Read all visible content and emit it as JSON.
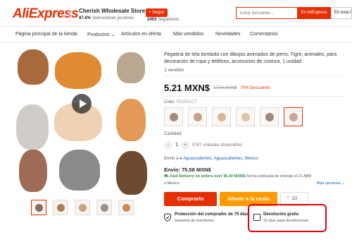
{
  "header": {
    "logo": "AliExpress",
    "store_name": "Cherish Wholesale Store",
    "store_rating_value": "97.6%",
    "store_rating_label": "Valoraciones positivas",
    "follow_label": "+ Seguir",
    "followers_count": "2403",
    "followers_label": "Seguidores",
    "search_placeholder": "Estoy buscando...",
    "search_aliexpress_label": "En AliExpress",
    "search_store_label": "En esta tienda"
  },
  "nav": {
    "items": [
      {
        "label": "Página principal de la tienda"
      },
      {
        "label": "Productos"
      },
      {
        "label": "Artículos en oferta"
      },
      {
        "label": "Más vendidos"
      },
      {
        "label": "Novedades"
      },
      {
        "label": "Comentarios"
      }
    ]
  },
  "product": {
    "title": "Pegatina de tela bordada con dibujos animados de perro, Tigre, animales, para decoración de ropa y teléfono, accesorios de costura, 1 unidad",
    "sold": "1 vendido",
    "price": "5.21 MXN$",
    "old_price": "17.54 MXN$",
    "discount": "70% Descuento",
    "color_label": "Color:",
    "color_value": "FE1501CT",
    "quantity_label": "Cantidad:",
    "quantity_minus": "-",
    "quantity_value": "1",
    "quantity_plus": "+",
    "quantity_available": "9767 unidades disponibles",
    "ship_prefix": "Envío a",
    "ship_location": "Aguascalientes, Aguascalientes, Mexico",
    "shipping_cost": "Envío: 75.58 MXN$",
    "fast_delivery": "Fast Delivery on orders over 96.40 MXN$",
    "delivery_estimate": "Fecha estimada de entrega el 21 ABR",
    "to_country": "a Mexico",
    "more_options": "Más opciones",
    "buy_label": "Comprarlo",
    "cart_label": "Añadir a la cesta",
    "wishlist_count": "10",
    "protection_title": "Protección del comprador de 75 días",
    "protection_sub": "Garantía de reembolso",
    "return_title": "Devolución gratis",
    "return_sub": "15 días para devoluciones"
  },
  "colors": {
    "brand": "#e62e04",
    "cart": "#ff9a00",
    "highlight": "#e8000b",
    "fast": "#2e8540"
  }
}
